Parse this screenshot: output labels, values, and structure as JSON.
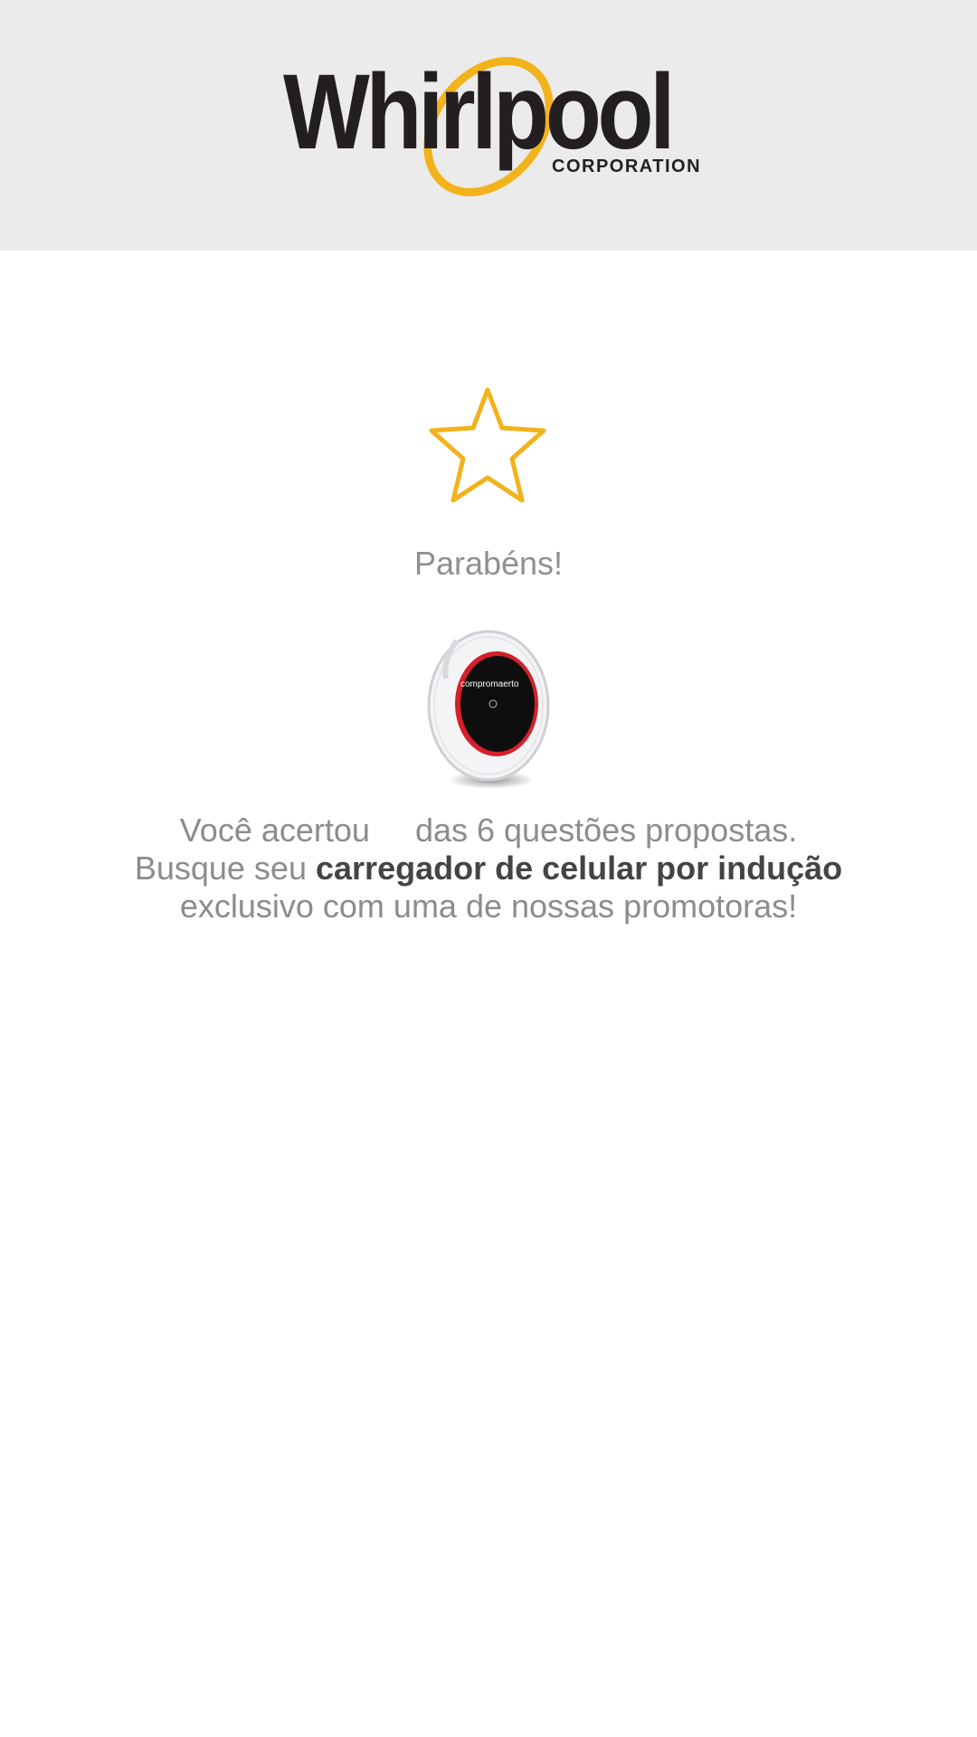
{
  "header": {
    "logo": {
      "brand": "Whirlpool",
      "tagline": "CORPORATION",
      "accent_color": "#f2b21b"
    }
  },
  "main": {
    "star_icon": "star-outline-icon",
    "star_color": "#f2b21b",
    "title": "Parabéns!",
    "prize_image": {
      "icon": "wireless-charger-image",
      "label_text": "compromaerto"
    },
    "message": {
      "line1_before": "Você acertou",
      "line1_after": "das 6 questões propostas.",
      "line2_before": "Busque seu",
      "line2_bold": "carregador de celular por indução",
      "line3": "exclusivo com uma de nossas promotoras!"
    }
  }
}
